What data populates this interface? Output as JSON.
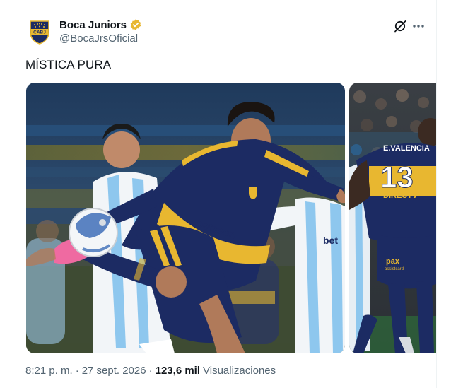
{
  "author": {
    "display_name": "Boca Juniors",
    "handle": "@BocaJrsOficial",
    "avatar_text": "CABJ",
    "verified_color": "#E8B730"
  },
  "tweet": {
    "text": "MÍSTICA PURA"
  },
  "media": {
    "photo_1": {
      "shirt_sponsor": "betsson"
    },
    "photo_2": {
      "player_name": "E.VALENCIA",
      "player_number": "13",
      "shirt_sponsor_1": "DIRECTV",
      "shirt_sponsor_2": "pax",
      "shirt_sponsor_3": "assistcard"
    }
  },
  "footer": {
    "time": "8:21 p. m.",
    "date": "27 sept. 2026",
    "views_count": "123,6 mil",
    "views_label": "Visualizaciones",
    "separator": "·"
  },
  "colors": {
    "boca_blue": "#1c2b63",
    "boca_gold": "#e8b730",
    "racing_sky": "#8ec7ee",
    "text_primary": "#0f1419",
    "text_secondary": "#536471"
  },
  "icons": [
    "verified-badge-icon",
    "grok-icon",
    "more-icon"
  ]
}
